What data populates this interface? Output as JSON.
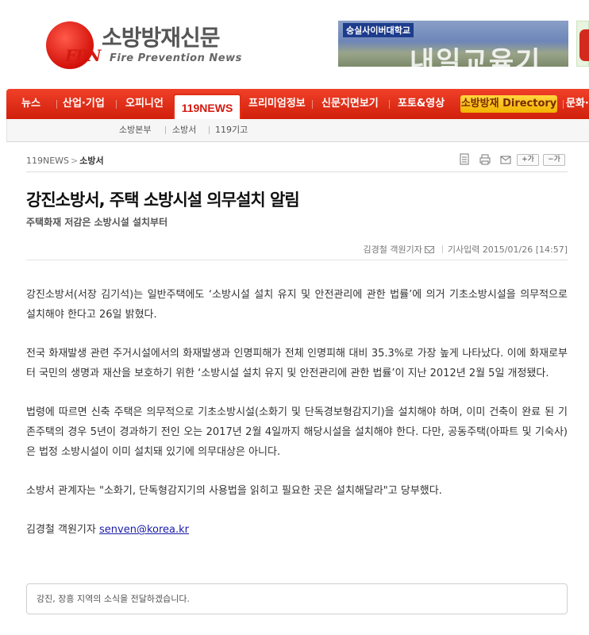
{
  "site": {
    "logo_ko": "소방방재신문",
    "logo_en": "Fire Prevention News",
    "logo_mark": "FPN"
  },
  "banner": {
    "school": "숭실사이버대학교",
    "text": "내일교육기"
  },
  "nav": {
    "items": [
      "뉴스",
      "산업·기업",
      "오피니언",
      "119NEWS",
      "프리미엄정보",
      "신문지면보기",
      "포토&영상",
      "소방방재 Directory",
      "문화·"
    ],
    "active": "119NEWS",
    "sub_items": [
      "소방본부",
      "소방서",
      "119기고"
    ]
  },
  "breadcrumb": {
    "section": "119NEWS",
    "current": "소방서"
  },
  "tools": {
    "font_up": "+가",
    "font_down": "−가"
  },
  "article": {
    "title": "강진소방서, 주택 소방시설 의무설치 알림",
    "subtitle": "주택화재 저감은 소방시설 설치부터",
    "reporter": "김경철 객원기자",
    "date_label": "기사입력",
    "date": "2015/01/26 [14:57]",
    "paragraphs": [
      "강진소방서(서장 김기석)는 일반주택에도 ‘소방시설 설치 유지 및 안전관리에 관한 법률’에 의거 기초소방시설을 의무적으로 설치해야 한다고 26일 밝혔다.",
      "전국 화재발생 관련 주거시설에서의 화재발생과 인명피해가 전체 인명피해 대비 35.3%로 가장 높게 나타났다. 이에 화재로부터 국민의 생명과 재산을 보호하기 위한 ‘소방시설 설치 유지 및 안전관리에 관한 법률’이 지난 2012년 2월 5일 개정됐다.",
      "법령에 따르면 신축 주택은 의무적으로 기초소방시설(소화기 및 단독경보형감지기)을 설치해야 하며, 이미 건축이 완료 된 기존주택의 경우 5년이 경과하기 전인 오는 2017년 2월 4일까지 해당시설을 설치해야 한다. 다만, 공동주택(아파트 및 기숙사)은 법정 소방시설이 이미 설치돼 있기에 의무대상은 아니다.",
      "소방서 관계자는 \"소화기, 단독형감지기의 사용법을 읽히고 필요한 곳은 설치해달라\"고 당부했다."
    ],
    "sign_name": "김경철 객원기자",
    "sign_email": "senven@korea.kr",
    "footer_note": "강진, 장흥 지역의 소식을 전달하겠습니다."
  }
}
